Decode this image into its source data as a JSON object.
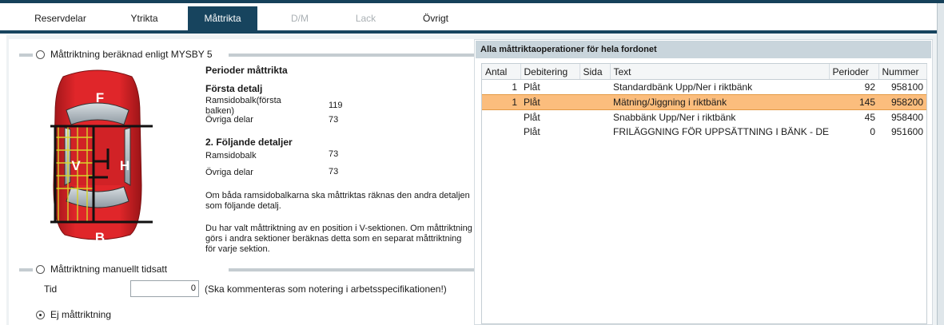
{
  "tabs": [
    {
      "label": "Reservdelar",
      "state": "normal"
    },
    {
      "label": "Ytrikta",
      "state": "normal"
    },
    {
      "label": "Måttrikta",
      "state": "active"
    },
    {
      "label": "D/M",
      "state": "disabled"
    },
    {
      "label": "Lack",
      "state": "disabled"
    },
    {
      "label": "Övrigt",
      "state": "normal"
    }
  ],
  "left": {
    "option_calculated": "Måttriktning beräknad enligt MYSBY 5",
    "periods_title": "Perioder måttrikta",
    "first_detail_title": "Första detalj",
    "first_detail_rows": [
      {
        "label": "Ramsidobalk(första balken)",
        "value": "119"
      },
      {
        "label": "Övriga delar",
        "value": "73"
      }
    ],
    "following_title": "2. Följande detaljer",
    "following_rows": [
      {
        "label": "Ramsidobalk",
        "value": "73"
      },
      {
        "label": "Övriga delar",
        "value": "73"
      }
    ],
    "info_1": "Om båda ramsidobalkarna ska måttriktas räknas den andra detaljen som följande detalj.",
    "info_2": "Du har valt måttriktning av en position i V-sektionen. Om måttriktning görs i andra sektioner beräknas detta som en separat måttriktning för varje sektion.",
    "option_manual": "Måttriktning manuellt tidsatt",
    "time_label": "Tid",
    "time_value": "0",
    "time_note": "(Ska kommenteras som notering i arbetsspecifikationen!)",
    "option_none": "Ej måttriktning",
    "selected_option": "none",
    "car": {
      "sections": {
        "front": "F",
        "left": "V",
        "right": "H",
        "back": "B"
      },
      "body_color": "#e0262a",
      "grid_color": "#d8d42a"
    }
  },
  "right": {
    "title": "Alla måttriktaoperationer för hela fordonet",
    "columns": [
      "Antal",
      "Debitering",
      "Sida",
      "Text",
      "Perioder",
      "Nummer"
    ],
    "rows": [
      {
        "antal": "1",
        "debitering": "Plåt",
        "sida": "",
        "text": "Standardbänk  Upp/Ner i riktbänk",
        "perioder": "92",
        "nummer": "958100",
        "selected": false
      },
      {
        "antal": "1",
        "debitering": "Plåt",
        "sida": "",
        "text": "Mätning/Jiggning i riktbänk",
        "perioder": "145",
        "nummer": "958200",
        "selected": true
      },
      {
        "antal": "",
        "debitering": "Plåt",
        "sida": "",
        "text": "Snabbänk Upp/Ner i riktbänk",
        "perioder": "45",
        "nummer": "958400",
        "selected": false
      },
      {
        "antal": "",
        "debitering": "Plåt",
        "sida": "",
        "text": "FRILÄGGNING FÖR UPPSÄTTNING I BÄNK - DEMO",
        "perioder": "0",
        "nummer": "951600",
        "selected": false
      }
    ],
    "highlight_color": "#fbbd7d"
  }
}
